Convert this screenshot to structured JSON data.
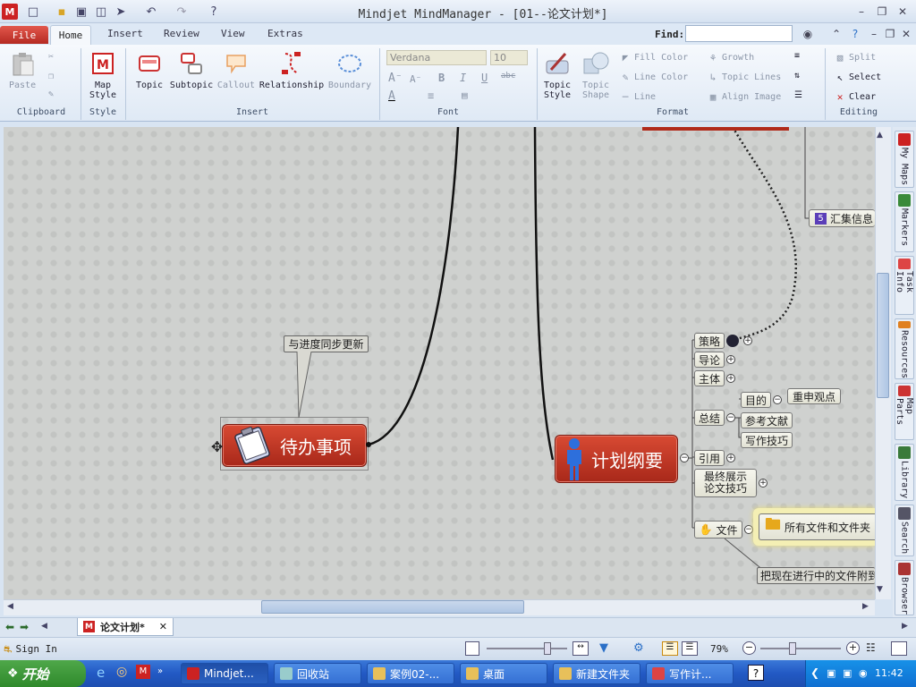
{
  "app": {
    "title": "Mindjet MindManager - [01--论文计划*]",
    "icon_label": "M"
  },
  "tabs": {
    "file": "File",
    "home": "Home",
    "insert": "Insert",
    "review": "Review",
    "view": "View",
    "extras": "Extras"
  },
  "find": {
    "label": "Find:",
    "value": ""
  },
  "ribbon": {
    "clipboard": {
      "label": "Clipboard",
      "paste": "Paste"
    },
    "style": {
      "label": "Style",
      "map_style": "Map\nStyle"
    },
    "insert": {
      "label": "Insert",
      "topic": "Topic",
      "subtopic": "Subtopic",
      "callout": "Callout",
      "relationship": "Relationship",
      "boundary": "Boundary"
    },
    "font": {
      "label": "Font",
      "name": "Verdana",
      "size": "10"
    },
    "format": {
      "label": "Format",
      "topic_style": "Topic\nStyle",
      "topic_shape": "Topic\nShape",
      "fill_color": "Fill Color",
      "line_color": "Line Color",
      "line": "Line",
      "growth": "Growth",
      "topic_lines": "Topic Lines",
      "align_image": "Align Image"
    },
    "editing": {
      "label": "Editing",
      "split": "Split",
      "select": "Select",
      "clear": "Clear"
    }
  },
  "map": {
    "central_left": "待办事项",
    "central_right": "计划纲要",
    "callout": "与进度同步更新",
    "topics": {
      "t1": "策略",
      "t2": "导论",
      "t3": "主体",
      "t4": "总结",
      "t5": "引用",
      "t6": "最终展示\n论文技巧",
      "t7": "文件",
      "s1": "目的",
      "s2": "参考文献",
      "s3": "写作技巧",
      "s4": "重申观点",
      "files": "所有文件和文件夹",
      "note": "把现在进行中的文件附到",
      "collect": "汇集信息",
      "collect_num": "5"
    }
  },
  "side_tabs": [
    "My Maps",
    "Markers",
    "Task Info",
    "Resources",
    "Map Parts",
    "Library",
    "Search",
    "Browser"
  ],
  "doc_tab": "论文计划*",
  "status": {
    "sign_in": "Sign In",
    "zoom": "79%"
  },
  "taskbar": {
    "start": "开始",
    "items": [
      "Mindjet...",
      "回收站",
      "案例02-...",
      "桌面",
      "新建文件夹",
      "写作计..."
    ],
    "clock": "11:42"
  }
}
